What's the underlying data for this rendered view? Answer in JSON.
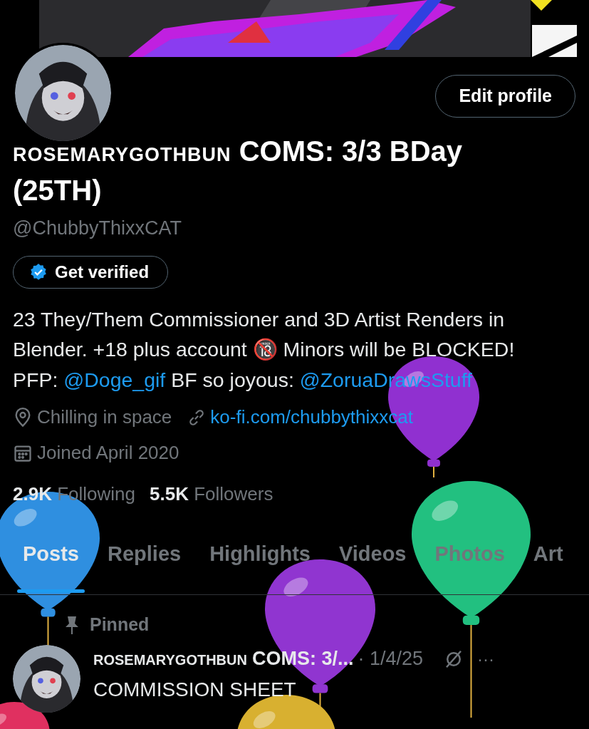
{
  "profile": {
    "edit_button": "Edit profile",
    "name_prefix": "ROSEMARYGOTHBUN",
    "name": "COMS: 3/3 BDay (25TH)",
    "handle": "@ChubbyThixxCAT",
    "verify_button": "Get verified",
    "bio": [
      {
        "kind": "text",
        "text": "23 They/Them Commissioner and 3D Artist Renders in Blender. +18 plus account "
      },
      {
        "kind": "emoji",
        "text": "🔞"
      },
      {
        "kind": "text",
        "text": " Minors will be BLOCKED! PFP: "
      },
      {
        "kind": "link",
        "text": "@Doge_gif"
      },
      {
        "kind": "text",
        "text": " BF so joyous: "
      },
      {
        "kind": "link",
        "text": "@ZoruaDrawsStuff"
      }
    ],
    "location": "Chilling in space",
    "website": "ko-fi.com/chubbythixxcat",
    "joined": "Joined April 2020",
    "following_count": "2.9K",
    "following_label": "Following",
    "followers_count": "5.5K",
    "followers_label": "Followers"
  },
  "tabs": [
    {
      "label": "Posts",
      "selected": true
    },
    {
      "label": "Replies",
      "selected": false
    },
    {
      "label": "Highlights",
      "selected": false
    },
    {
      "label": "Videos",
      "selected": false
    },
    {
      "label": "Photos",
      "selected": false
    },
    {
      "label": "Art",
      "selected": false
    }
  ],
  "pinned_post": {
    "pinned_label": "Pinned",
    "author_prefix": "ROSEMARYGOTHBUN",
    "author": "COMS: 3/...",
    "date": "· 1/4/25",
    "more": "···",
    "text": "COMMISSION SHEET"
  }
}
